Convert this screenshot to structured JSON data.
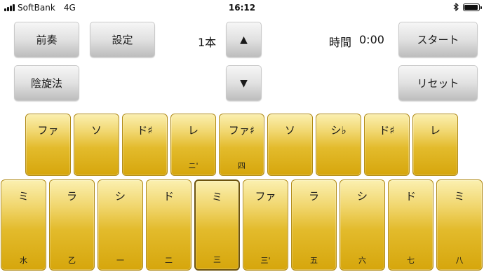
{
  "status_bar": {
    "carrier": "SoftBank",
    "network": "4G",
    "time": "16:12",
    "bluetooth_icon": "bluetooth-icon",
    "battery_level": 0.95
  },
  "controls": {
    "prelude_label": "前奏",
    "settings_label": "設定",
    "pitch_value": "1本",
    "up_arrow": "▲",
    "down_arrow": "▼",
    "time_label": "時間",
    "time_value": "0:00",
    "start_label": "スタート",
    "scale_label": "陰旋法",
    "reset_label": "リセット"
  },
  "keyboard": {
    "upper_row": [
      {
        "note": "ファ",
        "num": ""
      },
      {
        "note": "ソ",
        "num": ""
      },
      {
        "note": "ド♯",
        "num": ""
      },
      {
        "note": "レ",
        "num": "ニ'"
      },
      {
        "note": "ファ♯",
        "num": "四"
      },
      {
        "note": "ソ",
        "num": ""
      },
      {
        "note": "シ♭",
        "num": ""
      },
      {
        "note": "ド♯",
        "num": ""
      },
      {
        "note": "レ",
        "num": ""
      }
    ],
    "lower_row": [
      {
        "note": "ミ",
        "num": "水"
      },
      {
        "note": "ラ",
        "num": "乙"
      },
      {
        "note": "シ",
        "num": "一"
      },
      {
        "note": "ド",
        "num": "二"
      },
      {
        "note": "ミ",
        "num": "三"
      },
      {
        "note": "ファ",
        "num": "三'"
      },
      {
        "note": "ラ",
        "num": "五"
      },
      {
        "note": "シ",
        "num": "六"
      },
      {
        "note": "ド",
        "num": "七"
      },
      {
        "note": "ミ",
        "num": "八"
      }
    ],
    "selected_lower_index": 4
  },
  "colors": {
    "key_gold": "#e3bb2c",
    "key_border": "#b08a16",
    "button_grey": "#e1e1e1"
  }
}
